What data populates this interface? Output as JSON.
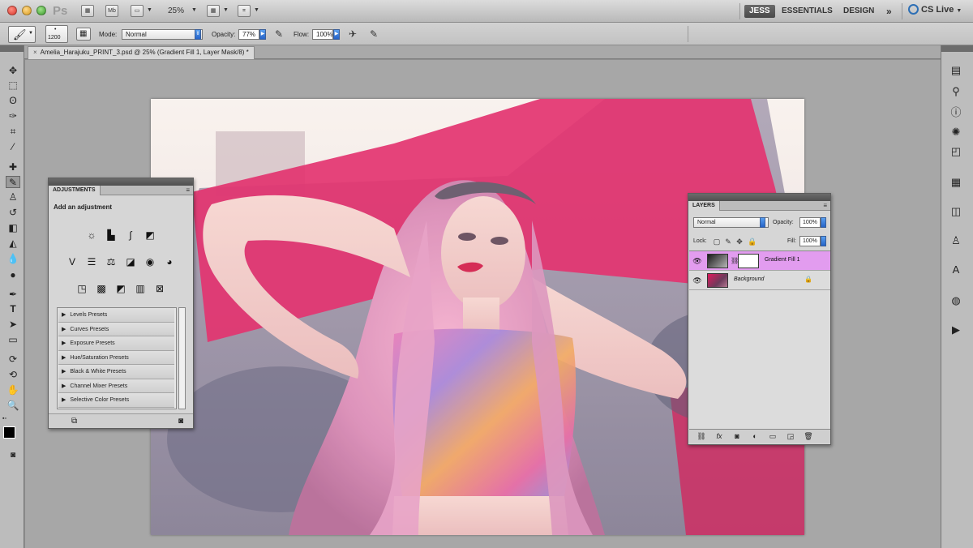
{
  "app": {
    "logo": "Ps",
    "zoom": "25%",
    "workspaces": [
      "JESS",
      "ESSENTIALS",
      "DESIGN"
    ],
    "more": "»",
    "cs_live": "CS Live"
  },
  "options": {
    "brush_size": "1200",
    "mode_label": "Mode:",
    "mode_value": "Normal",
    "opacity_label": "Opacity:",
    "opacity_value": "77%",
    "flow_label": "Flow:",
    "flow_value": "100%"
  },
  "document": {
    "tab_title": "Amelia_Harajuku_PRINT_3.psd @ 25% (Gradient Fill 1, Layer Mask/8) *",
    "close": "×"
  },
  "adjustments": {
    "tab": "ADJUSTMENTS",
    "heading": "Add an adjustment",
    "presets": [
      "Levels Presets",
      "Curves Presets",
      "Exposure Presets",
      "Hue/Saturation Presets",
      "Black & White Presets",
      "Channel Mixer Presets",
      "Selective Color Presets"
    ]
  },
  "layers": {
    "tab": "LAYERS",
    "blend_mode": "Normal",
    "opacity_label": "Opacity:",
    "opacity_value": "100%",
    "lock_label": "Lock:",
    "fill_label": "Fill:",
    "fill_value": "100%",
    "items": [
      {
        "name": "Gradient Fill 1",
        "selected": true
      },
      {
        "name": "Background",
        "selected": false
      }
    ]
  },
  "colors": {
    "selection": "#e29cef",
    "accent_magenta": "#e0195c"
  }
}
